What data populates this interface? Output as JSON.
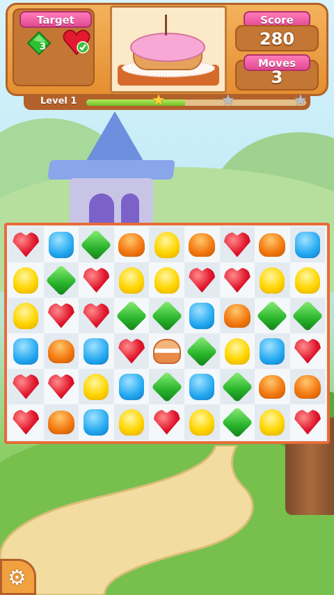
{
  "hud": {
    "target_label": "Target",
    "target_goals": [
      {
        "icon": "green-gem-icon",
        "count": "3"
      },
      {
        "icon": "red-heart-check-icon",
        "count": ""
      }
    ],
    "score_label": "Score",
    "score_value": "280",
    "moves_label": "Moves",
    "moves_value": "3",
    "level_label": "Level 1",
    "progress": 0.45,
    "stars": [
      {
        "name": "star-1-icon",
        "earned": true
      },
      {
        "name": "star-2-icon",
        "earned": false
      },
      {
        "name": "star-3-icon",
        "earned": false
      }
    ]
  },
  "board": {
    "rows": 6,
    "cols": 9,
    "pieces": [
      [
        "heart",
        "blue",
        "green",
        "orange",
        "yellow",
        "orange",
        "heart",
        "orange",
        "blue"
      ],
      [
        "yellow",
        "green",
        "heart",
        "yellow",
        "yellow",
        "heart",
        "heart",
        "yellow",
        "yellow"
      ],
      [
        "yellow",
        "heart",
        "heart",
        "green",
        "green",
        "blue",
        "orange",
        "green",
        "green"
      ],
      [
        "blue",
        "orange",
        "blue",
        "heart",
        "special",
        "green",
        "yellow",
        "blue",
        "heart"
      ],
      [
        "heart",
        "heart",
        "yellow",
        "blue",
        "green",
        "blue",
        "green",
        "orange",
        "orange"
      ],
      [
        "heart",
        "orange",
        "blue",
        "yellow",
        "heart",
        "yellow",
        "green",
        "yellow",
        "heart"
      ]
    ]
  },
  "colors": {
    "hud_orange": "#e48e30",
    "label_pink": "#e14b93",
    "board_border": "#e76c3a"
  },
  "settings": {
    "icon": "gear-icon"
  }
}
